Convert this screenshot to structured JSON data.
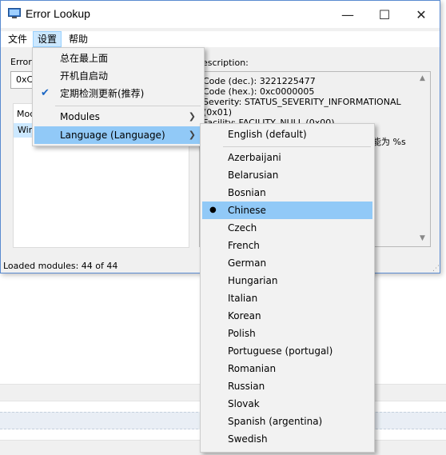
{
  "window": {
    "title": "Error Lookup",
    "minimize_glyph": "—",
    "maximize_glyph": "☐",
    "close_glyph": "✕"
  },
  "menubar": {
    "file": "文件",
    "settings": "设置",
    "help": "帮助"
  },
  "form": {
    "error_label": "Error",
    "error_value": "0xC0"
  },
  "modules": {
    "header": "Moc",
    "selected_row": "Win"
  },
  "description": {
    "label": "escription:",
    "lines": [
      "Code (dec.): 3221225477",
      "Code (hex.): 0xc0000005",
      "Severity: STATUS_SEVERITY_INFORMATIONAL",
      "(0x01)",
      "Facility: FACILITY_NULL (0x00)"
    ],
    "tail_text": "能为 %s"
  },
  "status": {
    "text": "Loaded modules: 44 of 44"
  },
  "settings_menu": {
    "items": [
      {
        "label": "总在最上面",
        "checked": false
      },
      {
        "label": "开机自启动",
        "checked": false
      },
      {
        "label": "定期检测更新(推荐)",
        "checked": true
      },
      {
        "label": "Modules",
        "submenu": true
      },
      {
        "label": "Language (Language)",
        "submenu": true,
        "highlighted": true
      }
    ]
  },
  "language_menu": {
    "default_item": "English (default)",
    "selected": "Chinese",
    "items": [
      "Azerbaijani",
      "Belarusian",
      "Bosnian",
      "Chinese",
      "Czech",
      "French",
      "German",
      "Hungarian",
      "Italian",
      "Korean",
      "Polish",
      "Portuguese (portugal)",
      "Romanian",
      "Russian",
      "Slovak",
      "Spanish (argentina)",
      "Swedish"
    ]
  },
  "colors": {
    "menu_highlight": "#91c9f7",
    "menubar_active": "#cce8ff",
    "check_blue": "#1a66c4"
  }
}
